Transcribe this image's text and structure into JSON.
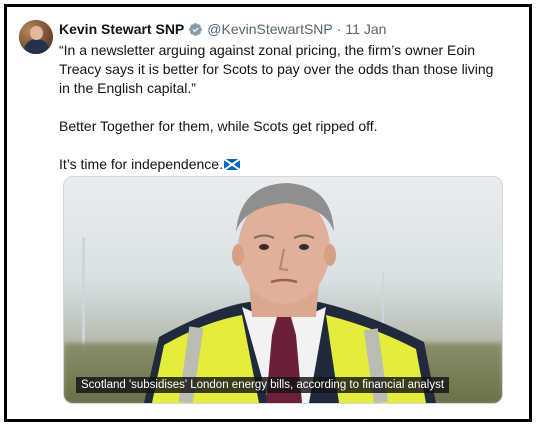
{
  "tweet": {
    "author_name": "Kevin Stewart SNP",
    "handle": "@KevinStewartSNP",
    "separator": "·",
    "date": "11 Jan",
    "text": "“In a newsletter arguing against zonal pricing, the firm’s owner Eoin Treacy says it is better for Scots to pay over the odds than those living in the English capital.”\n\nBetter Together for them, while Scots get ripped off.\n\nIt’s time for independence.",
    "flag_icon": "scotland-flag-icon",
    "verified_icon": "verified-badge-icon",
    "media": {
      "caption": "Scotland 'subsidises' London energy bills, according to financial analyst"
    }
  },
  "colors": {
    "text_primary": "#0f1419",
    "text_secondary": "#536471",
    "verified": "#1d9bf0",
    "flag_blue": "#0065bd",
    "vest_yellow": "#e7ee3a"
  }
}
